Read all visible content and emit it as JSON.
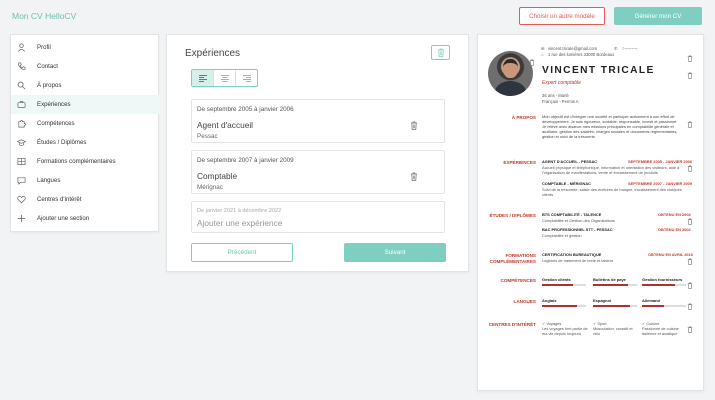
{
  "app": {
    "brand": "Mon CV HelloCV",
    "choose_model": "Choisir un autre modèle",
    "generate": "Générer mon CV"
  },
  "sidebar": {
    "items": [
      {
        "label": "Profil",
        "icon": "user-icon"
      },
      {
        "label": "Contact",
        "icon": "phone-icon"
      },
      {
        "label": "À propos",
        "icon": "search-icon"
      },
      {
        "label": "Expériences",
        "icon": "briefcase-icon",
        "active": true
      },
      {
        "label": "Compétences",
        "icon": "puzzle-icon"
      },
      {
        "label": "Études / Diplômes",
        "icon": "graduation-cap-icon"
      },
      {
        "label": "Formations complémentaires",
        "icon": "grid-icon"
      },
      {
        "label": "Langues",
        "icon": "chat-icon"
      },
      {
        "label": "Centres d'intérêt",
        "icon": "heart-icon"
      },
      {
        "label": "Ajouter une section",
        "icon": "plus-icon"
      }
    ]
  },
  "panel": {
    "title": "Expériences",
    "cards": [
      {
        "date": "De septembre 2005 à janvier 2006",
        "title": "Agent d'accueil",
        "place": "Pessac"
      },
      {
        "date": "De septembre 2007 à janvier 2009",
        "title": "Comptable",
        "place": "Mérignac"
      }
    ],
    "new_card": {
      "date": "De janvier 2021 à décembre 2022",
      "title": "Ajouter une expérience"
    },
    "prev": "Précédent",
    "next": "Suivant"
  },
  "cv": {
    "email": "vincent.tricale@gmail.com",
    "phone": "0▪▪▪▪▪▪▪▪▪",
    "address": "1 rue des lumières 33000 Bordeaux",
    "name": "VINCENT TRICALE",
    "job": "Expert comptable",
    "meta1": "36 ans - Marié",
    "meta2": "Français - Permis A",
    "sections": {
      "about": "À PROPOS",
      "experiences": "EXPÉRIENCES",
      "studies": "ÉTUDES / DIPLÔMES",
      "trainings": "FORMATIONS COMPLÉMENTAIRES",
      "skills": "COMPÉTENCES",
      "languages": "LANGUES",
      "interests": "CENTRES D'INTÉRÊT"
    },
    "about_text": "Mon objectif est d'intégrer une société et participer activement à son effort de développement. Je suis rigoureux, sociable, responsable, investi et passionné. Je relève avec aisance mes missions principales en comptabilité générale et auxiliaire, gestion des salaires, charges sociales et documents réglementaires, gestion et suivi de la trésorerie.",
    "experiences": [
      {
        "title": "AGENT D'ACCUEIL - PESSAC",
        "date": "SEPTEMBRE 2005 - JANVIER 2006",
        "desc": "Accueil physique et téléphonique, information et orientation des visiteurs, aide à l'organisation de manifestations, vente et encaissement de produits"
      },
      {
        "title": "COMPTABLE - MÉRIGNAC",
        "date": "SEPTEMBRE 2007 - JANVIER 2009",
        "desc": "Suivi de la trésorerie, saisie des écritures de banque, encaissement des chèques clients"
      }
    ],
    "studies": [
      {
        "title": "BTS COMPTABILITÉ - TALENCE",
        "date": "OBTENU EN 2004",
        "desc": "Comptabilité et Gestion des Organisations"
      },
      {
        "title": "BAC PROFESSIONNEL STT - PESSAC",
        "date": "OBTENU EN 2002",
        "desc": "Comptabilité et gestion"
      }
    ],
    "trainings": [
      {
        "title": "CERTIFICATION BUREAUTIQUE",
        "date": "OBTENU EN AVRIL 2010",
        "desc": "Logiciels de traitement de texte et tableur"
      }
    ],
    "skills": [
      {
        "name": "Gestion clients",
        "level": 0.7
      },
      {
        "name": "Bulletins de paye",
        "level": 0.8
      },
      {
        "name": "Gestion fournisseurs",
        "level": 0.75
      }
    ],
    "languages": [
      {
        "name": "Anglais",
        "level": 0.8
      },
      {
        "name": "Espagnol",
        "level": 0.85
      },
      {
        "name": "Allemand",
        "level": 0.5
      }
    ],
    "interests": [
      {
        "name": "Voyages",
        "desc": "Les voyages font partie de ma vie depuis toujours"
      },
      {
        "name": "Sport",
        "desc": "Musculation, crossfit et vélo"
      },
      {
        "name": "Cuisine",
        "desc": "Passionné de cuisine italienne et asiatique"
      }
    ]
  },
  "colors": {
    "accent": "#7fcfc0",
    "danger": "#e05a57",
    "cv_accent": "#c0392b"
  }
}
